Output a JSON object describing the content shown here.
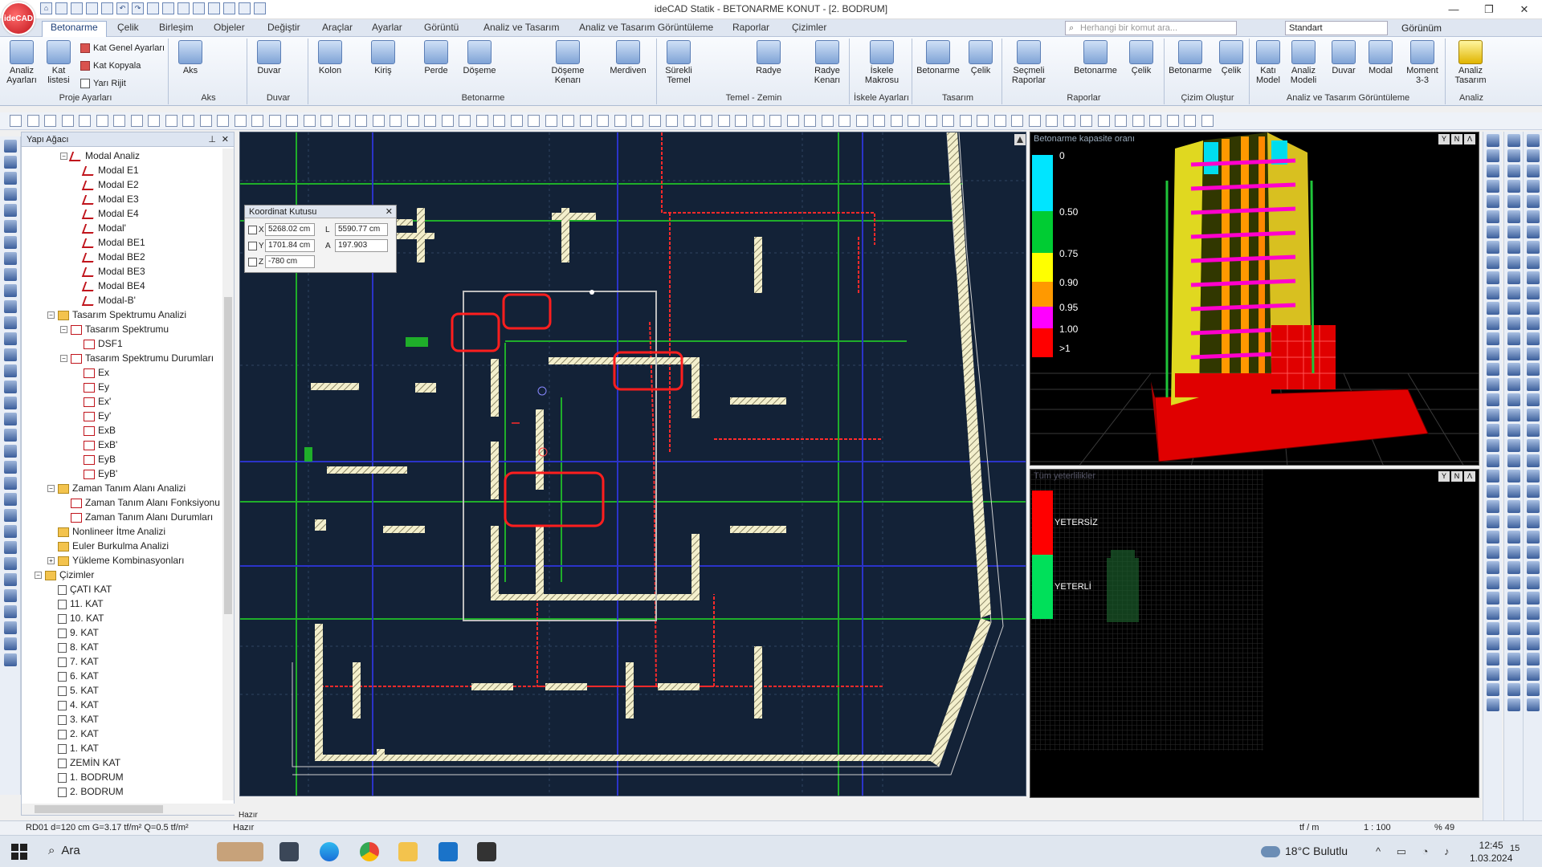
{
  "app": {
    "logo_text": "ideCAD",
    "window_title": "ideCAD Statik - BETONARME KONUT - [2. BODRUM]",
    "controls": [
      "—",
      "❐",
      "✕"
    ]
  },
  "menu": {
    "tabs": [
      "Betonarme",
      "Çelik",
      "Birleşim",
      "Objeler",
      "Değiştir",
      "Araçlar",
      "Ayarlar",
      "Görüntü",
      "Analiz ve Tasarım",
      "Analiz ve Tasarım Görüntüleme",
      "Raporlar",
      "Çizimler"
    ],
    "active_tab": "Betonarme",
    "command_search_placeholder": "Herhangi bir komut ara...",
    "style_value": "Standart",
    "view_label": "Görünüm"
  },
  "ribbon": {
    "groups": [
      {
        "label": "Proje Ayarları",
        "buttons": [
          "Analiz Ayarları",
          "Kat listesi"
        ],
        "small": [
          "Kat Genel Ayarları",
          "Kat Kopyala",
          "Yarı Rijit"
        ]
      },
      {
        "label": "Aks",
        "buttons": [
          "Aks"
        ]
      },
      {
        "label": "Duvar",
        "buttons": [
          "Duvar"
        ]
      },
      {
        "label": "Betonarme",
        "buttons": [
          "Kolon",
          "Kiriş",
          "Perde",
          "Döşeme",
          "Döşeme Kenarı",
          "Merdiven"
        ]
      },
      {
        "label": "Temel - Zemin",
        "buttons": [
          "Sürekli Temel",
          "Radye",
          "Radye Kenarı"
        ]
      },
      {
        "label": "İskele Ayarları",
        "buttons": [
          "İskele Makrosu"
        ]
      },
      {
        "label": "Tasarım",
        "buttons": [
          "Betonarme",
          "Çelik"
        ]
      },
      {
        "label": "Raporlar",
        "buttons": [
          "Seçmeli Raporlar",
          "Betonarme",
          "Çelik"
        ]
      },
      {
        "label": "Çizim Oluştur",
        "buttons": [
          "Betonarme",
          "Çelik"
        ]
      },
      {
        "label": "Analiz ve Tasarım Görüntüleme",
        "buttons": [
          "Katı Model",
          "Analiz Modeli",
          "Duvar",
          "Modal",
          "Moment 3-3"
        ]
      },
      {
        "label": "Analiz",
        "buttons": [
          "Analiz Tasarım"
        ]
      }
    ]
  },
  "tree": {
    "title": "Yapı Ağacı",
    "items": [
      {
        "label": "Modal Analiz",
        "level": 3,
        "icon": "modal",
        "exp": "−"
      },
      {
        "label": "Modal E1",
        "level": 4,
        "icon": "modal"
      },
      {
        "label": "Modal E2",
        "level": 4,
        "icon": "modal"
      },
      {
        "label": "Modal E3",
        "level": 4,
        "icon": "modal"
      },
      {
        "label": "Modal E4",
        "level": 4,
        "icon": "modal"
      },
      {
        "label": "Modal'",
        "level": 4,
        "icon": "modal"
      },
      {
        "label": "Modal BE1",
        "level": 4,
        "icon": "modal"
      },
      {
        "label": "Modal BE2",
        "level": 4,
        "icon": "modal"
      },
      {
        "label": "Modal BE3",
        "level": 4,
        "icon": "modal"
      },
      {
        "label": "Modal BE4",
        "level": 4,
        "icon": "modal"
      },
      {
        "label": "Modal-B'",
        "level": 4,
        "icon": "modal"
      },
      {
        "label": "Tasarım Spektrumu Analizi",
        "level": 2,
        "icon": "folder",
        "exp": "−"
      },
      {
        "label": "Tasarım Spektrumu",
        "level": 3,
        "icon": "chart",
        "exp": "−"
      },
      {
        "label": "DSF1",
        "level": 4,
        "icon": "chart"
      },
      {
        "label": "Tasarım Spektrumu Durumları",
        "level": 3,
        "icon": "chart",
        "exp": "−"
      },
      {
        "label": "Ex",
        "level": 4,
        "icon": "chart"
      },
      {
        "label": "Ey",
        "level": 4,
        "icon": "chart"
      },
      {
        "label": "Ex'",
        "level": 4,
        "icon": "chart"
      },
      {
        "label": "Ey'",
        "level": 4,
        "icon": "chart"
      },
      {
        "label": "ExB",
        "level": 4,
        "icon": "chart"
      },
      {
        "label": "ExB'",
        "level": 4,
        "icon": "chart"
      },
      {
        "label": "EyB",
        "level": 4,
        "icon": "chart"
      },
      {
        "label": "EyB'",
        "level": 4,
        "icon": "chart"
      },
      {
        "label": "Zaman Tanım Alanı Analizi",
        "level": 2,
        "icon": "folder",
        "exp": "−"
      },
      {
        "label": "Zaman Tanım Alanı Fonksiyonu",
        "level": 3,
        "icon": "chart"
      },
      {
        "label": "Zaman Tanım Alanı Durumları",
        "level": 3,
        "icon": "chart"
      },
      {
        "label": "Nonlineer İtme Analizi",
        "level": 2,
        "icon": "folder"
      },
      {
        "label": "Euler Burkulma Analizi",
        "level": 2,
        "icon": "folder"
      },
      {
        "label": "Yükleme Kombinasyonları",
        "level": 2,
        "icon": "folder",
        "exp": "+"
      },
      {
        "label": "Çizimler",
        "level": 1,
        "icon": "folder",
        "exp": "−"
      },
      {
        "label": "ÇATI KAT",
        "level": 2,
        "icon": "page"
      },
      {
        "label": "11. KAT",
        "level": 2,
        "icon": "page"
      },
      {
        "label": "10. KAT",
        "level": 2,
        "icon": "page"
      },
      {
        "label": "9. KAT",
        "level": 2,
        "icon": "page"
      },
      {
        "label": "8. KAT",
        "level": 2,
        "icon": "page"
      },
      {
        "label": "7. KAT",
        "level": 2,
        "icon": "page"
      },
      {
        "label": "6. KAT",
        "level": 2,
        "icon": "page"
      },
      {
        "label": "5. KAT",
        "level": 2,
        "icon": "page"
      },
      {
        "label": "4. KAT",
        "level": 2,
        "icon": "page"
      },
      {
        "label": "3. KAT",
        "level": 2,
        "icon": "page"
      },
      {
        "label": "2. KAT",
        "level": 2,
        "icon": "page"
      },
      {
        "label": "1. KAT",
        "level": 2,
        "icon": "page"
      },
      {
        "label": "ZEMİN KAT",
        "level": 2,
        "icon": "page"
      },
      {
        "label": "1. BODRUM",
        "level": 2,
        "icon": "page"
      },
      {
        "label": "2. BODRUM",
        "level": 2,
        "icon": "page"
      }
    ]
  },
  "coord_box": {
    "title": "Koordinat Kutusu",
    "x_label": "X",
    "x_value": "5268.02 cm",
    "y_label": "Y",
    "y_value": "1701.84 cm",
    "z_label": "Z",
    "z_value": "-780 cm",
    "l_label": "L",
    "l_value": "5590.77 cm",
    "a_label": "A",
    "a_value": "197.903"
  },
  "view3d": {
    "title": "Betonarme kapasite oranı",
    "legend": [
      {
        "label": "0",
        "color": "#00e5ff"
      },
      {
        "label": "0.50",
        "color": "#00cc33"
      },
      {
        "label": "0.75",
        "color": "#ffff00"
      },
      {
        "label": "0.90",
        "color": "#ff9900"
      },
      {
        "label": "0.95",
        "color": "#ff00ff"
      },
      {
        "label": "1.00",
        "color": "#ff0000"
      },
      {
        "label": ">1",
        "color": "#ff0000"
      }
    ],
    "buttons": [
      "Y",
      "N",
      "Λ"
    ]
  },
  "view_result": {
    "title": "Tüm yeterlilikler",
    "items": [
      {
        "label": "YETERSİZ",
        "color": "#ff0000"
      },
      {
        "label": "YETERLİ",
        "color": "#00e05a"
      }
    ]
  },
  "command_line": "Hazır",
  "status": {
    "left": "RD01 d=120 cm G=3.17 tf/m² Q=0.5 tf/m²",
    "state": "Hazır",
    "unit": "tf / m",
    "scale": "1 : 100",
    "zoom": "% 49"
  },
  "taskbar": {
    "search": "Ara",
    "weather": "18°C  Bulutlu",
    "time": "12:45",
    "date": "1.03.2024",
    "notifications": "15"
  }
}
